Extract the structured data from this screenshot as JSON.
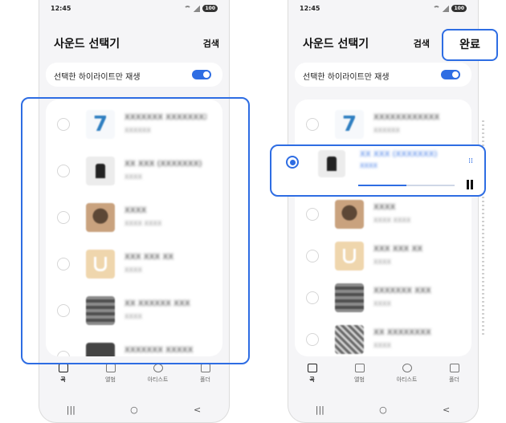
{
  "status": {
    "time": "12:45",
    "battery": "100"
  },
  "header": {
    "title": "사운드 선택기",
    "search_label": "검색",
    "done_label": "완료"
  },
  "highlight_toggle": {
    "label": "선택한 하이라이트만 재생",
    "on": true
  },
  "left_list": [
    {
      "title": "XXXXXXX XXXXXXXX",
      "subtitle": "XXXXXX",
      "thumb": "seven"
    },
    {
      "title": "XX XXX (XXXXXXX)",
      "subtitle": "XXXX",
      "thumb": "figure"
    },
    {
      "title": "XXXX",
      "subtitle": "XXXX XXXX",
      "thumb": "face"
    },
    {
      "title": "XXX XXX XX",
      "subtitle": "XXXX",
      "thumb": "u"
    },
    {
      "title": "XX XXXXXX XXX",
      "subtitle": "XXXX",
      "thumb": "stack"
    },
    {
      "title": "XXXXXXX XXXXX",
      "subtitle": "",
      "thumb": "dark"
    }
  ],
  "right_list": [
    {
      "title": "XXXXXXXXXXXX",
      "subtitle": "XXXXXX",
      "thumb": "seven"
    },
    {
      "title": "XXXX",
      "subtitle": "XXXX XXXX",
      "thumb": "face"
    },
    {
      "title": "XXX XXX XX",
      "subtitle": "XXXX",
      "thumb": "u"
    },
    {
      "title": "XXXXXXX XXX",
      "subtitle": "XXXX",
      "thumb": "stack"
    },
    {
      "title": "XX XXXXXXXX",
      "subtitle": "XXXX",
      "thumb": "mix"
    }
  ],
  "now_playing": {
    "title": "XX XXX (XXXXXXX)",
    "subtitle": "XXXX",
    "progress_fraction": 0.5
  },
  "bottom_nav": [
    {
      "label": "곡",
      "icon": "music-list-icon",
      "active": true
    },
    {
      "label": "앨범",
      "icon": "album-icon",
      "active": false
    },
    {
      "label": "아티스트",
      "icon": "artist-icon",
      "active": false
    },
    {
      "label": "폴더",
      "icon": "folder-icon",
      "active": false
    }
  ],
  "system_nav": {
    "recents": "|||",
    "home": "○",
    "back": "<"
  },
  "colors": {
    "accent": "#2e6de3",
    "background": "#f5f5f7",
    "card": "#ffffff"
  }
}
